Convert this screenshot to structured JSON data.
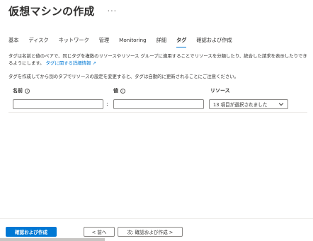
{
  "header": {
    "title": "仮想マシンの作成",
    "more": "···"
  },
  "tabs": [
    {
      "label": "基本",
      "active": false
    },
    {
      "label": "ディスク",
      "active": false
    },
    {
      "label": "ネットワーク",
      "active": false
    },
    {
      "label": "管理",
      "active": false
    },
    {
      "label": "Monitoring",
      "active": false
    },
    {
      "label": "詳細",
      "active": false
    },
    {
      "label": "タグ",
      "active": true
    },
    {
      "label": "確認および作成",
      "active": false
    }
  ],
  "description": {
    "text": "タグは名前と値のペアで、同じタグを複数のリソースやリソース グループに適用することでリソースを分類したり、統合した請求を表示したりできるようにします。",
    "link": "タグに関する詳細情報 ↗",
    "note": "タグを作成してから別のタブでリソースの設定を変更すると、タグは自動的に更新されることにご注意ください。"
  },
  "columns": {
    "name": "名前",
    "value": "値",
    "resource": "リソース"
  },
  "row": {
    "name_value": "",
    "separator": ":",
    "value_value": "",
    "resource_selected": "13 項目が選択されました"
  },
  "footer": {
    "review_create": "確認および作成",
    "prev": "< 前へ",
    "next": "次: 確認および作成 >"
  },
  "colors": {
    "accent": "#0078d4",
    "text": "#323130"
  }
}
